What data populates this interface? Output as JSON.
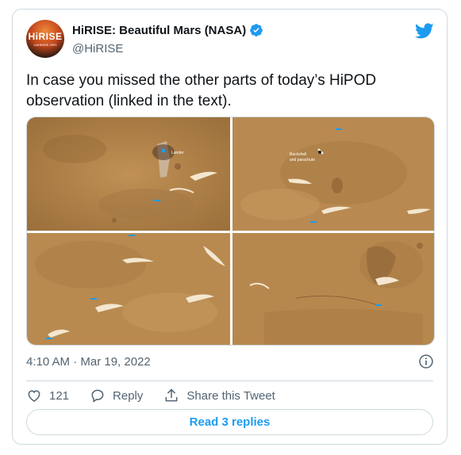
{
  "tweet": {
    "author_name": "HiRISE: Beautiful Mars (NASA)",
    "handle": "@HiRISE",
    "avatar_text": "HiRISE",
    "avatar_subtext": "UAHIRISE.ORG",
    "text": "In case you missed the other parts of today’s HiPOD observation (linked in the text).",
    "timestamp": "4:10 AM · Mar 19, 2022",
    "likes_count": "121",
    "reply_label": "Reply",
    "share_label": "Share this Tweet",
    "read_replies_label": "Read 3 replies"
  },
  "media": {
    "labels": {
      "lander": "Lander",
      "backshell": "Backshell",
      "parachute": "and parachute"
    }
  },
  "icons": {
    "verified": "verified-badge-icon",
    "bird": "twitter-bird-icon",
    "info": "info-icon",
    "heart": "heart-icon",
    "reply": "reply-bubble-icon",
    "share": "share-icon"
  },
  "colors": {
    "accent": "#1d9bf0",
    "text": "#0f1419",
    "muted": "#536471",
    "border": "#cfd9de",
    "mars": "#b98a4f"
  }
}
